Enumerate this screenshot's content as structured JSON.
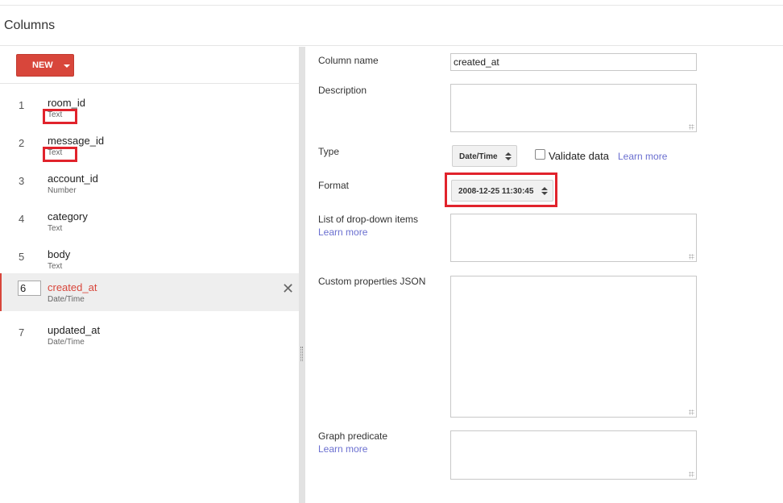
{
  "header": {
    "title": "Columns"
  },
  "toolbar": {
    "new_label": "NEW"
  },
  "columns": [
    {
      "num": "1",
      "name": "room_id",
      "type": "Text"
    },
    {
      "num": "2",
      "name": "message_id",
      "type": "Text"
    },
    {
      "num": "3",
      "name": "account_id",
      "type": "Number"
    },
    {
      "num": "4",
      "name": "category",
      "type": "Text"
    },
    {
      "num": "5",
      "name": "body",
      "type": "Text"
    },
    {
      "num": "6",
      "name": "created_at",
      "type": "Date/Time"
    },
    {
      "num": "7",
      "name": "updated_at",
      "type": "Date/Time"
    }
  ],
  "selected_index": "6",
  "form": {
    "column_name_label": "Column name",
    "column_name_value": "created_at",
    "description_label": "Description",
    "type_label": "Type",
    "type_value": "Date/Time",
    "validate_label": "Validate data",
    "learn_more": "Learn more",
    "format_label": "Format",
    "format_value": "2008-12-25 11:30:45",
    "dropdown_label": "List of drop-down items",
    "custom_json_label": "Custom properties JSON",
    "graph_label": "Graph predicate"
  },
  "colors": {
    "accent": "#d8463b",
    "highlight": "#e1232c",
    "link": "#6a6fd0"
  }
}
